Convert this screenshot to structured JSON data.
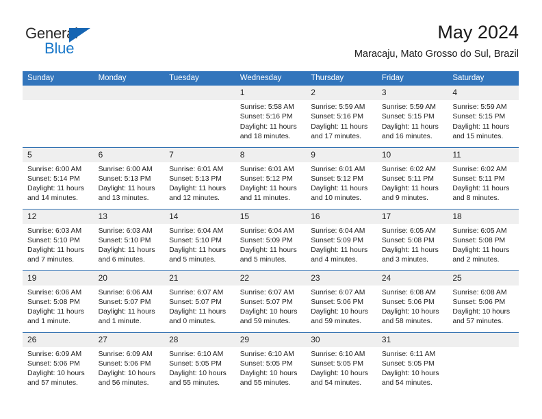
{
  "brand": {
    "word1": "General",
    "word2": "Blue",
    "triangle_color": "#1665b3",
    "word2_color": "#1877c9"
  },
  "header": {
    "title": "May 2024",
    "subtitle": "Maracaju, Mato Grosso do Sul, Brazil"
  },
  "theme": {
    "header_bg": "#3275bc",
    "row_divider": "#2f6fb0",
    "daynum_bg": "#efefef",
    "text": "#1d1d1d"
  },
  "calendar": {
    "weekday_headers": [
      "Sunday",
      "Monday",
      "Tuesday",
      "Wednesday",
      "Thursday",
      "Friday",
      "Saturday"
    ],
    "weeks": [
      [
        {
          "day": "",
          "sunrise": "",
          "sunset": "",
          "daylight1": "",
          "daylight2": ""
        },
        {
          "day": "",
          "sunrise": "",
          "sunset": "",
          "daylight1": "",
          "daylight2": ""
        },
        {
          "day": "",
          "sunrise": "",
          "sunset": "",
          "daylight1": "",
          "daylight2": ""
        },
        {
          "day": "1",
          "sunrise": "Sunrise: 5:58 AM",
          "sunset": "Sunset: 5:16 PM",
          "daylight1": "Daylight: 11 hours",
          "daylight2": "and 18 minutes."
        },
        {
          "day": "2",
          "sunrise": "Sunrise: 5:59 AM",
          "sunset": "Sunset: 5:16 PM",
          "daylight1": "Daylight: 11 hours",
          "daylight2": "and 17 minutes."
        },
        {
          "day": "3",
          "sunrise": "Sunrise: 5:59 AM",
          "sunset": "Sunset: 5:15 PM",
          "daylight1": "Daylight: 11 hours",
          "daylight2": "and 16 minutes."
        },
        {
          "day": "4",
          "sunrise": "Sunrise: 5:59 AM",
          "sunset": "Sunset: 5:15 PM",
          "daylight1": "Daylight: 11 hours",
          "daylight2": "and 15 minutes."
        }
      ],
      [
        {
          "day": "5",
          "sunrise": "Sunrise: 6:00 AM",
          "sunset": "Sunset: 5:14 PM",
          "daylight1": "Daylight: 11 hours",
          "daylight2": "and 14 minutes."
        },
        {
          "day": "6",
          "sunrise": "Sunrise: 6:00 AM",
          "sunset": "Sunset: 5:13 PM",
          "daylight1": "Daylight: 11 hours",
          "daylight2": "and 13 minutes."
        },
        {
          "day": "7",
          "sunrise": "Sunrise: 6:01 AM",
          "sunset": "Sunset: 5:13 PM",
          "daylight1": "Daylight: 11 hours",
          "daylight2": "and 12 minutes."
        },
        {
          "day": "8",
          "sunrise": "Sunrise: 6:01 AM",
          "sunset": "Sunset: 5:12 PM",
          "daylight1": "Daylight: 11 hours",
          "daylight2": "and 11 minutes."
        },
        {
          "day": "9",
          "sunrise": "Sunrise: 6:01 AM",
          "sunset": "Sunset: 5:12 PM",
          "daylight1": "Daylight: 11 hours",
          "daylight2": "and 10 minutes."
        },
        {
          "day": "10",
          "sunrise": "Sunrise: 6:02 AM",
          "sunset": "Sunset: 5:11 PM",
          "daylight1": "Daylight: 11 hours",
          "daylight2": "and 9 minutes."
        },
        {
          "day": "11",
          "sunrise": "Sunrise: 6:02 AM",
          "sunset": "Sunset: 5:11 PM",
          "daylight1": "Daylight: 11 hours",
          "daylight2": "and 8 minutes."
        }
      ],
      [
        {
          "day": "12",
          "sunrise": "Sunrise: 6:03 AM",
          "sunset": "Sunset: 5:10 PM",
          "daylight1": "Daylight: 11 hours",
          "daylight2": "and 7 minutes."
        },
        {
          "day": "13",
          "sunrise": "Sunrise: 6:03 AM",
          "sunset": "Sunset: 5:10 PM",
          "daylight1": "Daylight: 11 hours",
          "daylight2": "and 6 minutes."
        },
        {
          "day": "14",
          "sunrise": "Sunrise: 6:04 AM",
          "sunset": "Sunset: 5:10 PM",
          "daylight1": "Daylight: 11 hours",
          "daylight2": "and 5 minutes."
        },
        {
          "day": "15",
          "sunrise": "Sunrise: 6:04 AM",
          "sunset": "Sunset: 5:09 PM",
          "daylight1": "Daylight: 11 hours",
          "daylight2": "and 5 minutes."
        },
        {
          "day": "16",
          "sunrise": "Sunrise: 6:04 AM",
          "sunset": "Sunset: 5:09 PM",
          "daylight1": "Daylight: 11 hours",
          "daylight2": "and 4 minutes."
        },
        {
          "day": "17",
          "sunrise": "Sunrise: 6:05 AM",
          "sunset": "Sunset: 5:08 PM",
          "daylight1": "Daylight: 11 hours",
          "daylight2": "and 3 minutes."
        },
        {
          "day": "18",
          "sunrise": "Sunrise: 6:05 AM",
          "sunset": "Sunset: 5:08 PM",
          "daylight1": "Daylight: 11 hours",
          "daylight2": "and 2 minutes."
        }
      ],
      [
        {
          "day": "19",
          "sunrise": "Sunrise: 6:06 AM",
          "sunset": "Sunset: 5:08 PM",
          "daylight1": "Daylight: 11 hours",
          "daylight2": "and 1 minute."
        },
        {
          "day": "20",
          "sunrise": "Sunrise: 6:06 AM",
          "sunset": "Sunset: 5:07 PM",
          "daylight1": "Daylight: 11 hours",
          "daylight2": "and 1 minute."
        },
        {
          "day": "21",
          "sunrise": "Sunrise: 6:07 AM",
          "sunset": "Sunset: 5:07 PM",
          "daylight1": "Daylight: 11 hours",
          "daylight2": "and 0 minutes."
        },
        {
          "day": "22",
          "sunrise": "Sunrise: 6:07 AM",
          "sunset": "Sunset: 5:07 PM",
          "daylight1": "Daylight: 10 hours",
          "daylight2": "and 59 minutes."
        },
        {
          "day": "23",
          "sunrise": "Sunrise: 6:07 AM",
          "sunset": "Sunset: 5:06 PM",
          "daylight1": "Daylight: 10 hours",
          "daylight2": "and 59 minutes."
        },
        {
          "day": "24",
          "sunrise": "Sunrise: 6:08 AM",
          "sunset": "Sunset: 5:06 PM",
          "daylight1": "Daylight: 10 hours",
          "daylight2": "and 58 minutes."
        },
        {
          "day": "25",
          "sunrise": "Sunrise: 6:08 AM",
          "sunset": "Sunset: 5:06 PM",
          "daylight1": "Daylight: 10 hours",
          "daylight2": "and 57 minutes."
        }
      ],
      [
        {
          "day": "26",
          "sunrise": "Sunrise: 6:09 AM",
          "sunset": "Sunset: 5:06 PM",
          "daylight1": "Daylight: 10 hours",
          "daylight2": "and 57 minutes."
        },
        {
          "day": "27",
          "sunrise": "Sunrise: 6:09 AM",
          "sunset": "Sunset: 5:06 PM",
          "daylight1": "Daylight: 10 hours",
          "daylight2": "and 56 minutes."
        },
        {
          "day": "28",
          "sunrise": "Sunrise: 6:10 AM",
          "sunset": "Sunset: 5:05 PM",
          "daylight1": "Daylight: 10 hours",
          "daylight2": "and 55 minutes."
        },
        {
          "day": "29",
          "sunrise": "Sunrise: 6:10 AM",
          "sunset": "Sunset: 5:05 PM",
          "daylight1": "Daylight: 10 hours",
          "daylight2": "and 55 minutes."
        },
        {
          "day": "30",
          "sunrise": "Sunrise: 6:10 AM",
          "sunset": "Sunset: 5:05 PM",
          "daylight1": "Daylight: 10 hours",
          "daylight2": "and 54 minutes."
        },
        {
          "day": "31",
          "sunrise": "Sunrise: 6:11 AM",
          "sunset": "Sunset: 5:05 PM",
          "daylight1": "Daylight: 10 hours",
          "daylight2": "and 54 minutes."
        },
        {
          "day": "",
          "sunrise": "",
          "sunset": "",
          "daylight1": "",
          "daylight2": ""
        }
      ]
    ]
  }
}
